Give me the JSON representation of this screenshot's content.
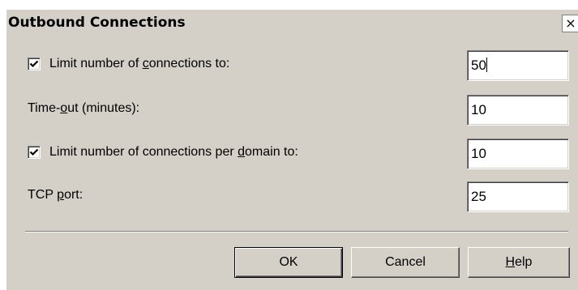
{
  "dialog": {
    "title": "Outbound Connections",
    "close_glyph": "×",
    "close_icon": "close-icon"
  },
  "fields": {
    "limit_connections": {
      "checked": true,
      "label_before": "Limit number of ",
      "label_accel": "c",
      "label_after": "onnections to:",
      "value": "50"
    },
    "timeout": {
      "label_before": "Time-",
      "label_accel": "o",
      "label_after": "ut (minutes):",
      "value": "10"
    },
    "limit_per_domain": {
      "checked": true,
      "label_before": "Limit number of connections per ",
      "label_accel": "d",
      "label_after": "omain to:",
      "value": "10"
    },
    "tcp_port": {
      "label_before": "TCP ",
      "label_accel": "p",
      "label_after": "ort:",
      "value": "25"
    }
  },
  "buttons": {
    "ok": "OK",
    "cancel": "Cancel",
    "help_accel": "H",
    "help_rest": "elp"
  },
  "colors": {
    "dialog_face": "#d4d0c8",
    "field_bg": "#ffffff",
    "shadow": "#808080"
  }
}
